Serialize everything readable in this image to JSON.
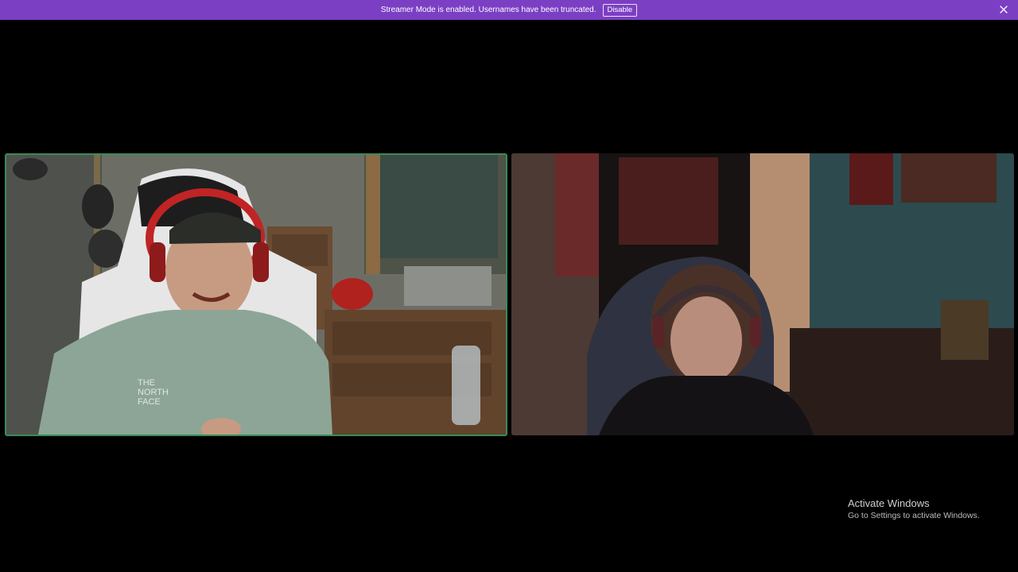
{
  "notice_bar": {
    "message": "Streamer Mode is enabled. Usernames have been truncated.",
    "disable_label": "Disable",
    "close_icon": "close-icon",
    "color": "#7b3fc4"
  },
  "call": {
    "participants": [
      {
        "tile": "video-tile-left",
        "speaking": true,
        "speaking_ring_color": "#3b8a5a"
      },
      {
        "tile": "video-tile-right",
        "speaking": false
      }
    ]
  },
  "watermark": {
    "title": "Activate Windows",
    "subtitle": "Go to Settings to activate Windows."
  }
}
